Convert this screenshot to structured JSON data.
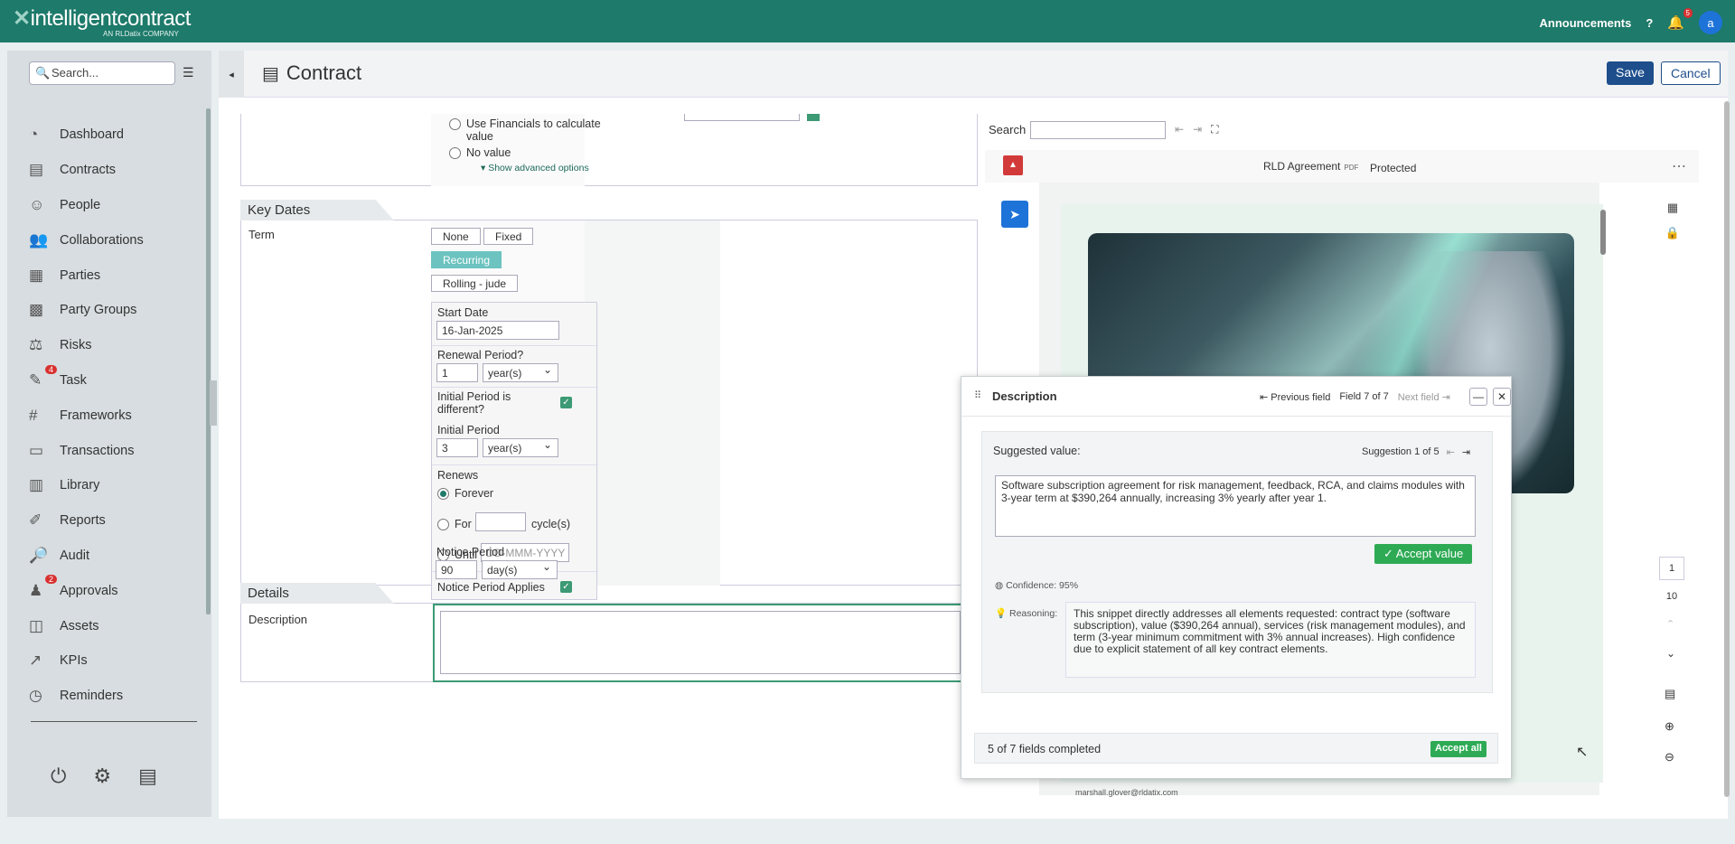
{
  "topbar": {
    "brand": "intelligentcontract",
    "brand_sub": "AN RLDatix COMPANY",
    "announcements": "Announcements",
    "help": "?",
    "notif_count": "5",
    "avatar": "a"
  },
  "sidebar": {
    "search_placeholder": "Search...",
    "items": [
      {
        "label": "Dashboard",
        "icon": "dashboard-icon"
      },
      {
        "label": "Contracts",
        "icon": "contracts-icon"
      },
      {
        "label": "People",
        "icon": "people-icon"
      },
      {
        "label": "Collaborations",
        "icon": "collaborations-icon"
      },
      {
        "label": "Parties",
        "icon": "parties-icon"
      },
      {
        "label": "Party Groups",
        "icon": "party-groups-icon"
      },
      {
        "label": "Risks",
        "icon": "risks-icon"
      },
      {
        "label": "Task",
        "icon": "task-icon",
        "badge": "4"
      },
      {
        "label": "Frameworks",
        "icon": "frameworks-icon"
      },
      {
        "label": "Transactions",
        "icon": "transactions-icon"
      },
      {
        "label": "Library",
        "icon": "library-icon"
      },
      {
        "label": "Reports",
        "icon": "reports-icon"
      },
      {
        "label": "Audit",
        "icon": "audit-icon"
      },
      {
        "label": "Approvals",
        "icon": "approvals-icon",
        "badge": "2"
      },
      {
        "label": "Assets",
        "icon": "assets-icon"
      },
      {
        "label": "KPIs",
        "icon": "kpis-icon"
      },
      {
        "label": "Reminders",
        "icon": "reminders-icon"
      }
    ]
  },
  "header": {
    "title": "Contract",
    "save": "Save",
    "cancel": "Cancel"
  },
  "form": {
    "financials": {
      "opt_use": "Use Financials to calculate value",
      "opt_none": "No value",
      "advanced": "Show advanced options"
    },
    "key_dates": {
      "section": "Key Dates",
      "term_label": "Term",
      "term_options": [
        "None",
        "Fixed",
        "Recurring",
        "Rolling - jude"
      ],
      "selected_term": "Recurring",
      "start_date_label": "Start Date",
      "start_date": "16-Jan-2025",
      "renewal_label": "Renewal Period?",
      "renewal_value": "1",
      "renewal_unit": "year(s)",
      "initial_diff_label": "Initial Period is different?",
      "initial_label": "Initial Period",
      "initial_value": "3",
      "initial_unit": "year(s)",
      "renews_label": "Renews",
      "renews_forever": "Forever",
      "renews_for": "For",
      "renews_cycles": "cycle(s)",
      "renews_until": "Until",
      "until_placeholder": "DD-MMM-YYYY",
      "notice_applies_label": "Notice Period Applies",
      "notice_label": "Notice Period",
      "notice_value": "90",
      "notice_unit": "day(s)"
    },
    "details": {
      "section": "Details",
      "description_label": "Description"
    }
  },
  "viewer": {
    "search_label": "Search",
    "doc_name": "RLD Agreement",
    "doc_type": "PDF",
    "doc_status": "Protected",
    "email": "marshall.glover@rldatix.com",
    "page_current": "1",
    "page_total": "10"
  },
  "panel": {
    "title": "Description",
    "prev": "Previous field",
    "field_pos": "Field 7 of 7",
    "next": "Next field",
    "suggested_label": "Suggested value:",
    "suggestion_pos": "Suggestion 1 of 5",
    "suggestion_text": "Software subscription agreement for risk management, feedback, RCA, and claims modules with 3-year term at $390,264 annually, increasing 3% yearly after year 1.",
    "accept_value": "✓ Accept value",
    "confidence": "Confidence: 95%",
    "reasoning_label": "Reasoning:",
    "reasoning": "This snippet directly addresses all elements requested: contract type (software subscription), value ($390,264 annual), services (risk management modules), and term (3-year minimum commitment with 3% annual increases). High confidence due to explicit statement of all key contract elements.",
    "footer_status": "5 of 7 fields completed",
    "accept_all": "Accept all"
  }
}
